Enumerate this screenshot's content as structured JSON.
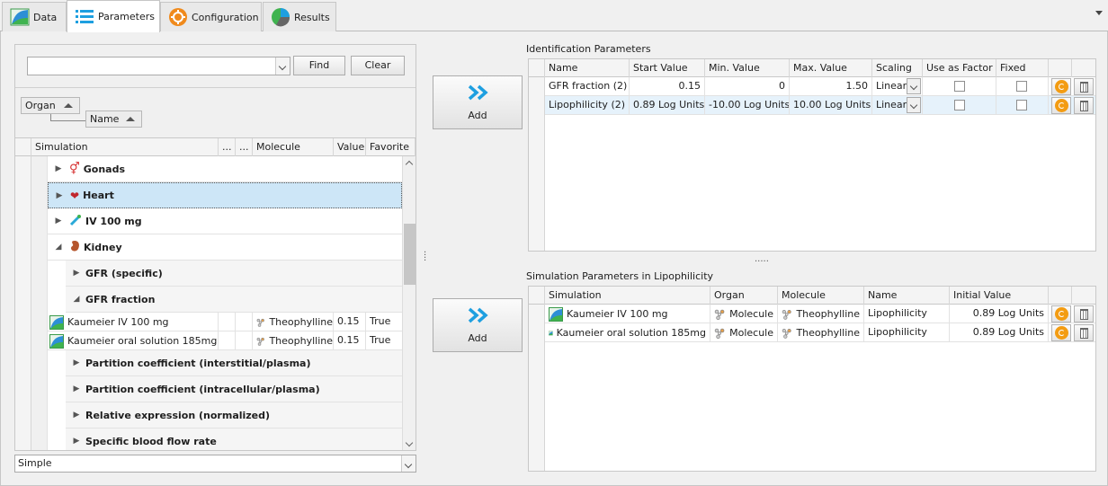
{
  "tabs": [
    {
      "label": "Data",
      "icon": "data-chart-icon"
    },
    {
      "label": "Parameters",
      "icon": "list-icon"
    },
    {
      "label": "Configuration",
      "icon": "gear-icon"
    },
    {
      "label": "Results",
      "icon": "pie-chart-icon"
    }
  ],
  "search": {
    "value": "",
    "find_label": "Find",
    "clear_label": "Clear"
  },
  "grouping": {
    "level1": "Organ",
    "level2": "Name"
  },
  "tree": {
    "columns": [
      "Simulation",
      "...",
      "...",
      "Molecule",
      "Value",
      "Favorite"
    ],
    "organs": [
      {
        "label": "Gonads",
        "icon": "gonads-icon",
        "expanded": false
      },
      {
        "label": "Heart",
        "icon": "heart-icon",
        "expanded": false,
        "selected": true
      },
      {
        "label": "IV 100 mg",
        "icon": "iv-icon",
        "expanded": false
      },
      {
        "label": "Kidney",
        "icon": "kidney-icon",
        "expanded": true
      }
    ],
    "kidney_children": [
      {
        "label": "GFR (specific)",
        "expanded": false
      },
      {
        "label": "GFR fraction",
        "expanded": true
      },
      {
        "label": "Partition coefficient (interstitial/plasma)",
        "expanded": false
      },
      {
        "label": "Partition coefficient (intracellular/plasma)",
        "expanded": false
      },
      {
        "label": "Relative expression (normalized)",
        "expanded": false
      },
      {
        "label": "Specific blood flow rate",
        "expanded": false
      }
    ],
    "gfr_fraction_rows": [
      {
        "simulation": "Kaumeier IV 100 mg",
        "molecule": "Theophylline",
        "value": "0.15",
        "favorite": "True"
      },
      {
        "simulation": "Kaumeier oral solution 185mg",
        "molecule": "Theophylline",
        "value": "0.15",
        "favorite": "True"
      }
    ]
  },
  "mode": {
    "value": "Simple"
  },
  "add_buttons": {
    "top_label": "Add",
    "bottom_label": "Add"
  },
  "identification": {
    "title": "Identification Parameters",
    "columns": [
      "Name",
      "Start Value",
      "Min. Value",
      "Max. Value",
      "Scaling",
      "Use as Factor",
      "Fixed"
    ],
    "rows": [
      {
        "name": "GFR fraction (2)",
        "start": "0.15",
        "min": "0",
        "max": "1.50",
        "scaling": "Linear",
        "use_as_factor": false,
        "fixed": false
      },
      {
        "name": "Lipophilicity (2)",
        "start": "0.89 Log Units",
        "min": "-10.00 Log Units",
        "max": "10.00 Log Units",
        "scaling": "Linear",
        "use_as_factor": false,
        "fixed": false
      }
    ]
  },
  "simulation_params": {
    "title": "Simulation Parameters in Lipophilicity",
    "columns": [
      "Simulation",
      "Organ",
      "Molecule",
      "Name",
      "Initial Value"
    ],
    "rows": [
      {
        "simulation": "Kaumeier IV 100 mg",
        "organ": "Molecule",
        "molecule": "Theophylline",
        "name": "Lipophilicity",
        "initial": "0.89 Log Units"
      },
      {
        "simulation": "Kaumeier oral solution 185mg",
        "organ": "Molecule",
        "molecule": "Theophylline",
        "name": "Lipophilicity",
        "initial": "0.89 Log Units"
      }
    ]
  },
  "colors": {
    "accent": "#1e9fe0",
    "selection": "#cde6f7",
    "refresh": "#f39c12"
  }
}
